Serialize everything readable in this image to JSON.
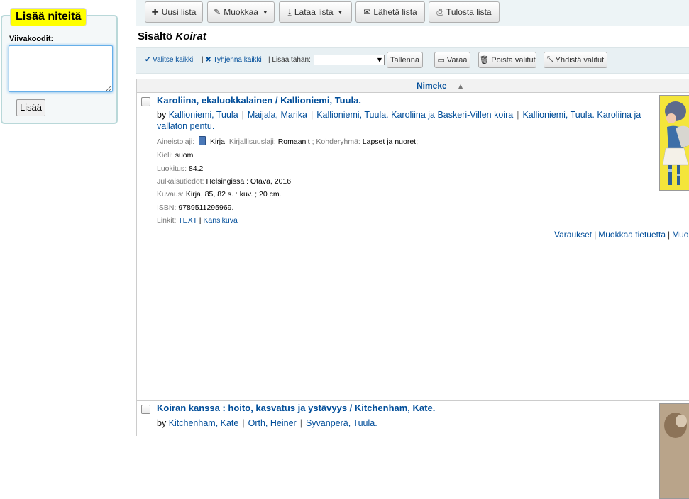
{
  "sidebar": {
    "legend": "Lisää niteitä",
    "barcodes_label": "Viivakoodit:",
    "barcodes_value": "",
    "add_button": "Lisää"
  },
  "toolbar": {
    "new_list": "Uusi lista",
    "edit": "Muokkaa",
    "download": "Lataa lista",
    "send": "Lähetä lista",
    "print": "Tulosta lista"
  },
  "heading": {
    "prefix": "Sisältö",
    "list_name": "Koirat"
  },
  "selection": {
    "select_all": "Valitse kaikki",
    "clear_all": "Tyhjennä kaikki",
    "add_to_label": "| Lisää tähän:",
    "add_to_value": "",
    "save": "Tallenna",
    "hold": "Varaa",
    "remove_selected": "Poista valitut",
    "merge_selected": "Yhdistä valitut"
  },
  "table": {
    "title_header": "Nimeke"
  },
  "records": [
    {
      "title": "Karoliina, ekaluokkalainen / Kallioniemi, Tuula.",
      "by": "by",
      "authors": [
        "Kallioniemi, Tuula",
        "Maijala, Marika",
        "Kallioniemi, Tuula. Karoliina ja Baskeri-Villen koira",
        "Kallioniemi, Tuula. Karoliina ja vallaton pentu."
      ],
      "material_type_label": "Aineistolaji:",
      "material_type": "Kirja",
      "literary_genre_label": "; Kirjallisuuslaji:",
      "literary_genre": "Romaanit",
      "audience_label": "; Kohderyhmä:",
      "audience": "Lapset ja nuoret;",
      "language_label": "Kieli:",
      "language": "suomi",
      "classification_label": "Luokitus:",
      "classification": "84.2",
      "publication_label": "Julkaisutiedot:",
      "publication": "Helsingissä : Otava, 2016",
      "description_label": "Kuvaus:",
      "description": "Kirja, 85, 82 s. : kuv. ; 20 cm.",
      "isbn_label": "ISBN:",
      "isbn": "9789511295969.",
      "links_label": "Linkit:",
      "link_text": "TEXT",
      "link_sep": "|",
      "link_cover": "Kansikuva",
      "actions": [
        "Varaukset",
        "Muokkaa tietuetta",
        "Muok"
      ]
    },
    {
      "title": "Koiran kanssa : hoito, kasvatus ja ystävyys / Kitchenham, Kate.",
      "by": "by",
      "authors": [
        "Kitchenham, Kate",
        "Orth, Heiner",
        "Syvänperä, Tuula."
      ]
    }
  ],
  "icons": {
    "plus": "plus-icon",
    "pencil": "pencil-icon",
    "download": "download-icon",
    "envelope": "envelope-icon",
    "print": "print-icon",
    "check": "check-icon",
    "x": "x-icon",
    "bookmark": "bookmark-icon",
    "trash": "trash-icon",
    "merge": "merge-icon"
  },
  "colors": {
    "link": "#004d99",
    "legend_highlight": "#ffff00",
    "panel_border": "#b9d8d9",
    "toolbar_bg": "#edf4f6"
  }
}
